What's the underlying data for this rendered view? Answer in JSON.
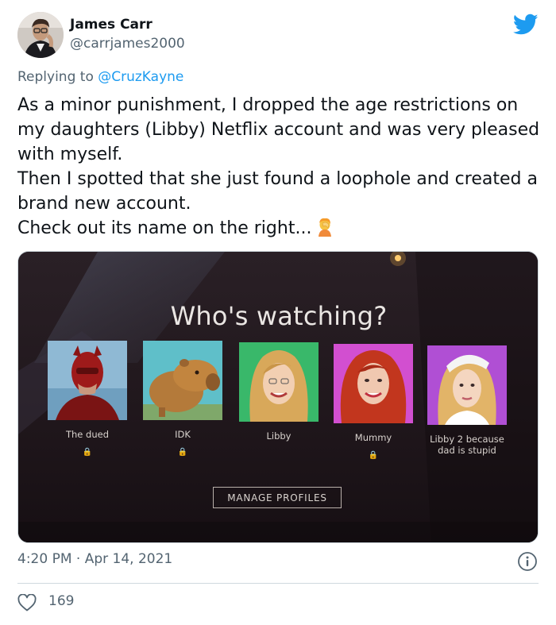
{
  "author": {
    "name": "James Carr",
    "handle": "@carrjames2000",
    "avatar_icon": "avatar-photo"
  },
  "platform_icon": "twitter-bird-icon",
  "brand_color": "#1d9bf0",
  "reply": {
    "prefix": "Replying to ",
    "mention": "@CruzKayne"
  },
  "tweet_lines": [
    "As a minor punishment, I dropped the age restrictions on my daughters (Libby) Netflix account and was very pleased with myself.",
    "Then I spotted that she just found a loophole and created a brand new account.",
    "Check out its name on the right..."
  ],
  "emoji_icon": "facepalm-emoji-icon",
  "media": {
    "heading": "Who's watching?",
    "profiles": [
      {
        "label": "The dued",
        "locked": true,
        "icon": "masked-hero-icon"
      },
      {
        "label": "IDK",
        "locked": true,
        "icon": "capybara-icon"
      },
      {
        "label": "Libby",
        "locked": false,
        "icon": "blonde-woman-icon"
      },
      {
        "label": "Mummy",
        "locked": true,
        "icon": "redhead-woman-icon"
      },
      {
        "label": "Libby 2 because dad is stupid",
        "locked": false,
        "icon": "blonde-girl-icon"
      }
    ],
    "lock_glyph": "🔒",
    "manage_button": "MANAGE PROFILES"
  },
  "timestamp": "4:20 PM · Apr 14, 2021",
  "likes": "169",
  "info_icon": "info-icon",
  "heart_icon": "heart-icon"
}
